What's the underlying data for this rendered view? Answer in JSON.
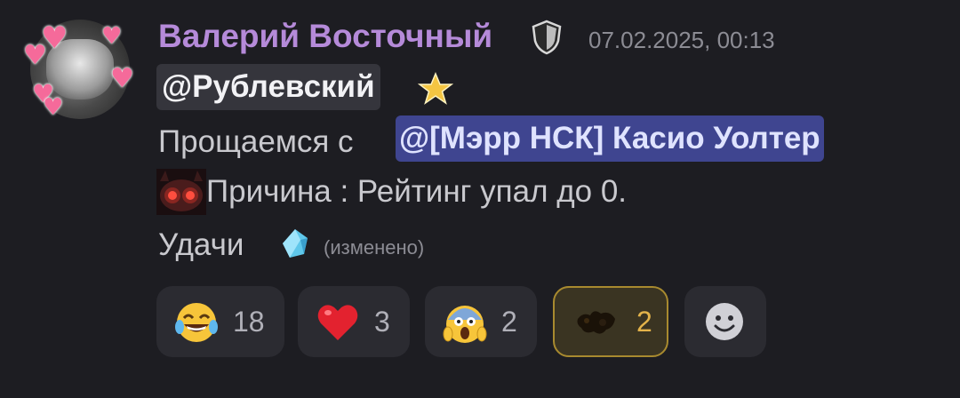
{
  "author": {
    "name": "Валерий Восточный",
    "timestamp": "07.02.2025, 00:13",
    "role_badge_icon": "shield-icon"
  },
  "message": {
    "reply_mention": "@Рублевский",
    "reply_badge_icon": "star-icon",
    "line1_prefix": "Прощаемся с",
    "line1_mention": "@[Мэрр НСК] Касио Уолтер",
    "line2_emoji_icon": "devil-eyes-emoji",
    "line2_text": "Причина : Рейтинг упал до 0.",
    "line3_text": "Удачи",
    "line3_emoji_icon": "crystal-icon",
    "edited_label": "(изменено)"
  },
  "reactions": [
    {
      "emoji": "laughing-tears-emoji",
      "count": "18"
    },
    {
      "emoji": "red-heart-emoji",
      "count": "3"
    },
    {
      "emoji": "screaming-face-emoji",
      "count": "2"
    },
    {
      "emoji": "custom-emoji",
      "count": "2",
      "selected": true
    }
  ],
  "add_reaction_icon": "add-reaction-smile-icon",
  "colors": {
    "background": "#1d1d22",
    "username": "#b58ad9",
    "mention_bg": "#3f4590",
    "reaction_bg": "#2b2b31",
    "reaction_selected_border": "#a88a2f",
    "reaction_selected_count": "#e3b34a"
  }
}
